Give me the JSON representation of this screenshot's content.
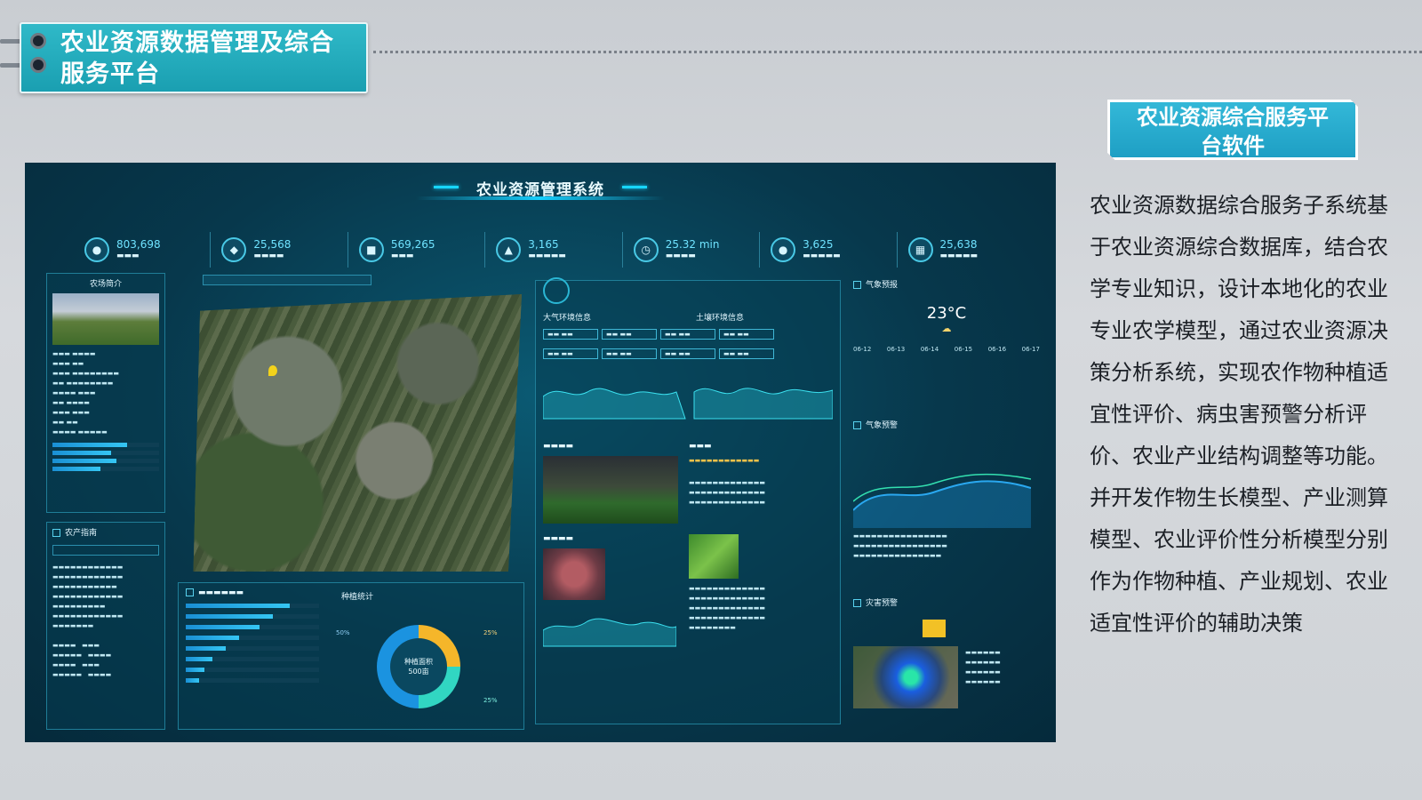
{
  "slide": {
    "title_line1": "农业资源数据管理及综合",
    "title_line2": "服务平台",
    "badge_line1": "农业资源综合服务平",
    "badge_line2": "台软件",
    "paragraphs": [
      "农业资源数据综合服务子系统基于农业资源综合数据库，结合农学专业知识，设计本地化的农业专业农学模型，通过农业资源决策分析系统，实现农作物种植适宜性评价、病虫害预警分析评价、农业产业结构调整等功能。",
      "并开发作物生长模型、产业测算模型、农业评价性分析模型分别作为作物种植、产业规划、农业适宜性评价的辅助决策"
    ]
  },
  "dashboard": {
    "title": "农业资源管理系统",
    "stats": [
      {
        "value": "803,698",
        "icon": "user-icon"
      },
      {
        "value": "25,568",
        "icon": "leaf-icon"
      },
      {
        "value": "569,265",
        "icon": "database-icon"
      },
      {
        "value": "3,165",
        "icon": "chart-icon"
      },
      {
        "value": "25.32 min",
        "icon": "clock-icon"
      },
      {
        "value": "3,625",
        "icon": "people-icon"
      },
      {
        "value": "25,638",
        "icon": "grid-icon"
      }
    ],
    "left_panel_title": "农场简介",
    "production_title": "农产指南",
    "env_title": "大气环境信息",
    "soil_title": "土壤环境信息",
    "weather_title": "气象预报",
    "temperature": "23°C",
    "weather2_title": "气象预警",
    "disaster_title": "灾害预警",
    "stats_panel_title": "种植统计",
    "pie_center_label": "种植面积",
    "pie_center_value": "500亩",
    "pie_legend": [
      {
        "label": "25%",
        "color": "#f5b62a"
      },
      {
        "label": "25%",
        "color": "#31d6c2"
      },
      {
        "label": "50%",
        "color": "#1b93e0"
      }
    ],
    "bar_list": [
      0.78,
      0.65,
      0.55,
      0.4,
      0.3,
      0.2,
      0.14,
      0.1
    ],
    "forecast_days": [
      "06-12",
      "06-13",
      "06-14",
      "06-15",
      "06-16",
      "06-17"
    ],
    "accent": "#17d6ff"
  }
}
